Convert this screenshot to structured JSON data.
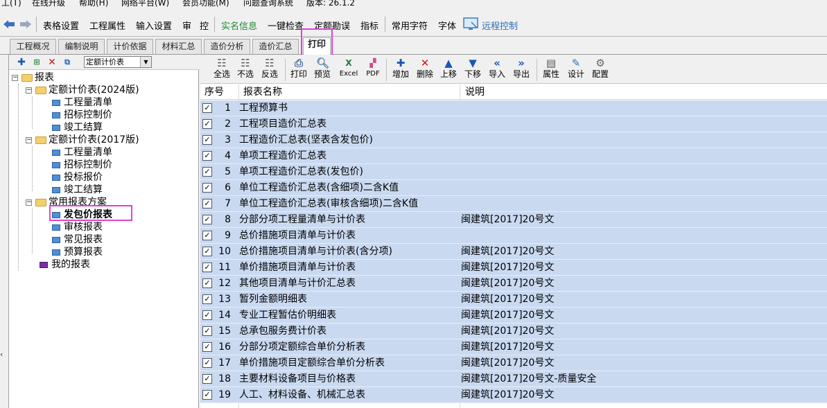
{
  "menubar": [
    "工(T)",
    "在线升级",
    "帮助(H)",
    "网络平台(W)",
    "会员功能(M)",
    "问题查询系统",
    "版本: 26.1.2"
  ],
  "toolbar": {
    "table_settings": "表格设置",
    "project_props": "工程属性",
    "input_settings": "输入设置",
    "audit": "审",
    "control": "控",
    "realname": "实名信息",
    "one_click_check": "一键检查",
    "quota_correct": "定额勘误",
    "indicator": "指标",
    "common_chars": "常用字符",
    "font": "字体",
    "remote": "远程控制"
  },
  "tabs": [
    "工程概况",
    "编制说明",
    "计价依据",
    "材料汇总",
    "造价分析",
    "造价汇总",
    "打印"
  ],
  "left": {
    "scheme": "定额计价表",
    "tree": {
      "root": "报表",
      "g2024": "定额计价表(2024版)",
      "g2024_items": [
        "工程量清单",
        "招标控制价",
        "竣工结算"
      ],
      "g2017": "定额计价表(2017版)",
      "g2017_items": [
        "工程量清单",
        "招标控制价",
        "投标报价",
        "竣工结算"
      ],
      "common": "常用报表方案",
      "common_items": [
        "发包价报表",
        "审核报表",
        "常见报表",
        "预算报表"
      ],
      "mine": "我的报表"
    }
  },
  "rtools": [
    "全选",
    "不选",
    "反选",
    "打印",
    "预览",
    "Excel",
    "PDF",
    "增加",
    "删除",
    "上移",
    "下移",
    "导入",
    "导出",
    "属性",
    "设计",
    "配置"
  ],
  "table": {
    "headers": {
      "seq": "序号",
      "name": "报表名称",
      "desc": "说明"
    },
    "rows": [
      {
        "n": "1",
        "name": "工程预算书",
        "desc": ""
      },
      {
        "n": "2",
        "name": "工程项目造价汇总表",
        "desc": ""
      },
      {
        "n": "3",
        "name": "工程造价汇总表(坚表含发包价)",
        "desc": ""
      },
      {
        "n": "4",
        "name": "单项工程造价汇总表",
        "desc": ""
      },
      {
        "n": "5",
        "name": "单项工程造价汇总表(发包价)",
        "desc": ""
      },
      {
        "n": "6",
        "name": "单位工程造价汇总表(含细项)二含K值",
        "desc": ""
      },
      {
        "n": "7",
        "name": "单位工程造价汇总表(审核含细项)二含K值",
        "desc": ""
      },
      {
        "n": "8",
        "name": "分部分项工程量清单与计价表",
        "desc": "闽建筑[2017]20号文"
      },
      {
        "n": "9",
        "name": "总价措施项目清单与计价表",
        "desc": ""
      },
      {
        "n": "10",
        "name": "总价措施项目清单与计价表(含分项)",
        "desc": "闽建筑[2017]20号文"
      },
      {
        "n": "11",
        "name": "单价措施项目清单与计价表",
        "desc": "闽建筑[2017]20号文"
      },
      {
        "n": "12",
        "name": "其他项目清单与计价汇总表",
        "desc": "闽建筑[2017]20号文"
      },
      {
        "n": "13",
        "name": "暂列金额明细表",
        "desc": "闽建筑[2017]20号文"
      },
      {
        "n": "14",
        "name": "专业工程暂估价明细表",
        "desc": "闽建筑[2017]20号文"
      },
      {
        "n": "15",
        "name": "总承包服务费计价表",
        "desc": "闽建筑[2017]20号文"
      },
      {
        "n": "16",
        "name": "分部分项定额综合单价分析表",
        "desc": "闽建筑[2017]20号文"
      },
      {
        "n": "17",
        "name": "单价措施项目定额综合单价分析表",
        "desc": "闽建筑[2017]20号文"
      },
      {
        "n": "18",
        "name": "主要材料设备项目与价格表",
        "desc": "闽建筑[2017]20号文-质量安全"
      },
      {
        "n": "19",
        "name": "人工、材料设备、机械汇总表",
        "desc": "闽建筑[2017]20号文"
      }
    ]
  },
  "colors": {
    "row_bg": "#c9d9f0",
    "highlight": "#e040d8",
    "green_text": "#1f8a34"
  }
}
